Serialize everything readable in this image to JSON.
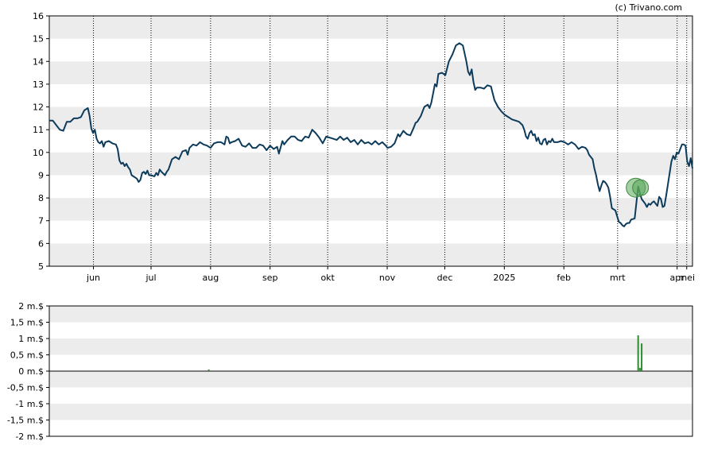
{
  "credit": "(c) Trivano.com",
  "chart_data": [
    {
      "type": "line",
      "ylim": [
        5,
        16
      ],
      "y_ticks": [
        "5",
        "6",
        "7",
        "8",
        "9",
        "10",
        "11",
        "12",
        "13",
        "14",
        "15",
        "16"
      ],
      "x_ticks": [
        "jun",
        "jul",
        "aug",
        "sep",
        "okt",
        "nov",
        "dec",
        "2025",
        "feb",
        "mrt",
        "apr",
        "mei"
      ],
      "grid": "vertical dotted at month boundaries, alternating horizontal bands",
      "line_color": "#0d3b5b",
      "x_range_days": [
        0,
        335
      ],
      "series": [
        {
          "points": [
            [
              0,
              11.4
            ],
            [
              2,
              11.4
            ],
            [
              4,
              11.2
            ],
            [
              6,
              11.0
            ],
            [
              8,
              10.95
            ],
            [
              10,
              11.35
            ],
            [
              12,
              11.35
            ],
            [
              14,
              11.5
            ],
            [
              16,
              11.5
            ],
            [
              18,
              11.55
            ],
            [
              20,
              11.85
            ],
            [
              22,
              11.95
            ],
            [
              23,
              11.6
            ],
            [
              24,
              11.05
            ],
            [
              25,
              10.85
            ],
            [
              26,
              11.0
            ],
            [
              27,
              10.6
            ],
            [
              28,
              10.45
            ],
            [
              29,
              10.4
            ],
            [
              30,
              10.5
            ],
            [
              31,
              10.25
            ],
            [
              32,
              10.45
            ],
            [
              34,
              10.5
            ],
            [
              36,
              10.4
            ],
            [
              38,
              10.35
            ],
            [
              39,
              10.15
            ],
            [
              40,
              9.65
            ],
            [
              41,
              9.5
            ],
            [
              42,
              9.55
            ],
            [
              43,
              9.4
            ],
            [
              44,
              9.5
            ],
            [
              45,
              9.35
            ],
            [
              46,
              9.25
            ],
            [
              47,
              9.0
            ],
            [
              48,
              8.95
            ],
            [
              50,
              8.85
            ],
            [
              51,
              8.7
            ],
            [
              52,
              8.8
            ],
            [
              53,
              9.1
            ],
            [
              54,
              9.15
            ],
            [
              55,
              9.05
            ],
            [
              56,
              9.2
            ],
            [
              57,
              9.0
            ],
            [
              58,
              9.0
            ],
            [
              60,
              8.95
            ],
            [
              61,
              9.1
            ],
            [
              62,
              9.0
            ],
            [
              63,
              9.25
            ],
            [
              64,
              9.15
            ],
            [
              66,
              9.0
            ],
            [
              67,
              9.15
            ],
            [
              68,
              9.25
            ],
            [
              70,
              9.7
            ],
            [
              72,
              9.8
            ],
            [
              74,
              9.7
            ],
            [
              76,
              10.05
            ],
            [
              78,
              10.1
            ],
            [
              79,
              9.9
            ],
            [
              80,
              10.2
            ],
            [
              82,
              10.35
            ],
            [
              84,
              10.3
            ],
            [
              86,
              10.45
            ],
            [
              88,
              10.35
            ],
            [
              90,
              10.3
            ],
            [
              92,
              10.2
            ],
            [
              94,
              10.4
            ],
            [
              96,
              10.45
            ],
            [
              98,
              10.45
            ],
            [
              100,
              10.35
            ],
            [
              101,
              10.7
            ],
            [
              102,
              10.65
            ],
            [
              103,
              10.4
            ],
            [
              104,
              10.45
            ],
            [
              106,
              10.5
            ],
            [
              108,
              10.6
            ],
            [
              110,
              10.3
            ],
            [
              112,
              10.25
            ],
            [
              114,
              10.4
            ],
            [
              116,
              10.2
            ],
            [
              118,
              10.2
            ],
            [
              120,
              10.35
            ],
            [
              122,
              10.3
            ],
            [
              124,
              10.1
            ],
            [
              126,
              10.3
            ],
            [
              128,
              10.15
            ],
            [
              130,
              10.25
            ],
            [
              131,
              9.95
            ],
            [
              133,
              10.5
            ],
            [
              134,
              10.35
            ],
            [
              136,
              10.55
            ],
            [
              138,
              10.7
            ],
            [
              140,
              10.7
            ],
            [
              142,
              10.55
            ],
            [
              144,
              10.5
            ],
            [
              146,
              10.7
            ],
            [
              148,
              10.65
            ],
            [
              150,
              11.0
            ],
            [
              152,
              10.85
            ],
            [
              154,
              10.65
            ],
            [
              156,
              10.4
            ],
            [
              158,
              10.7
            ],
            [
              160,
              10.65
            ],
            [
              162,
              10.6
            ],
            [
              164,
              10.55
            ],
            [
              166,
              10.7
            ],
            [
              168,
              10.55
            ],
            [
              170,
              10.65
            ],
            [
              172,
              10.45
            ],
            [
              174,
              10.55
            ],
            [
              176,
              10.35
            ],
            [
              178,
              10.55
            ],
            [
              180,
              10.4
            ],
            [
              182,
              10.45
            ],
            [
              184,
              10.35
            ],
            [
              186,
              10.5
            ],
            [
              188,
              10.35
            ],
            [
              190,
              10.45
            ],
            [
              192,
              10.3
            ],
            [
              193,
              10.2
            ],
            [
              195,
              10.25
            ],
            [
              197,
              10.4
            ],
            [
              199,
              10.8
            ],
            [
              200,
              10.7
            ],
            [
              202,
              10.95
            ],
            [
              204,
              10.8
            ],
            [
              206,
              10.75
            ],
            [
              208,
              11.1
            ],
            [
              209,
              11.3
            ],
            [
              210,
              11.35
            ],
            [
              212,
              11.6
            ],
            [
              214,
              12.0
            ],
            [
              216,
              12.1
            ],
            [
              217,
              11.95
            ],
            [
              218,
              12.2
            ],
            [
              219,
              12.6
            ],
            [
              220,
              13.0
            ],
            [
              221,
              12.9
            ],
            [
              222,
              13.45
            ],
            [
              224,
              13.5
            ],
            [
              226,
              13.4
            ],
            [
              228,
              14.0
            ],
            [
              230,
              14.3
            ],
            [
              232,
              14.7
            ],
            [
              234,
              14.8
            ],
            [
              236,
              14.7
            ],
            [
              237,
              14.35
            ],
            [
              238,
              14.0
            ],
            [
              239,
              13.55
            ],
            [
              240,
              13.4
            ],
            [
              241,
              13.65
            ],
            [
              242,
              13.1
            ],
            [
              243,
              12.75
            ],
            [
              244,
              12.85
            ],
            [
              246,
              12.85
            ],
            [
              248,
              12.8
            ],
            [
              250,
              12.95
            ],
            [
              252,
              12.9
            ],
            [
              253,
              12.6
            ],
            [
              254,
              12.3
            ],
            [
              256,
              12.0
            ],
            [
              258,
              11.8
            ],
            [
              260,
              11.65
            ],
            [
              262,
              11.55
            ],
            [
              264,
              11.45
            ],
            [
              266,
              11.4
            ],
            [
              268,
              11.35
            ],
            [
              270,
              11.2
            ],
            [
              271,
              11.0
            ],
            [
              272,
              10.7
            ],
            [
              273,
              10.6
            ],
            [
              274,
              10.85
            ],
            [
              275,
              10.95
            ],
            [
              276,
              10.75
            ],
            [
              277,
              10.8
            ],
            [
              278,
              10.5
            ],
            [
              279,
              10.65
            ],
            [
              280,
              10.4
            ],
            [
              281,
              10.35
            ],
            [
              282,
              10.55
            ],
            [
              283,
              10.6
            ],
            [
              284,
              10.35
            ],
            [
              285,
              10.5
            ],
            [
              286,
              10.45
            ],
            [
              287,
              10.6
            ],
            [
              288,
              10.45
            ],
            [
              290,
              10.45
            ],
            [
              292,
              10.5
            ],
            [
              294,
              10.45
            ],
            [
              296,
              10.35
            ],
            [
              298,
              10.45
            ],
            [
              300,
              10.35
            ],
            [
              302,
              10.15
            ],
            [
              304,
              10.25
            ],
            [
              306,
              10.2
            ],
            [
              307,
              10.1
            ],
            [
              308,
              9.9
            ],
            [
              310,
              9.7
            ],
            [
              311,
              9.3
            ],
            [
              312,
              9.0
            ],
            [
              313,
              8.6
            ],
            [
              314,
              8.3
            ],
            [
              315,
              8.55
            ],
            [
              316,
              8.75
            ],
            [
              317,
              8.7
            ],
            [
              318,
              8.6
            ],
            [
              319,
              8.45
            ],
            [
              320,
              8.05
            ],
            [
              321,
              7.55
            ],
            [
              322,
              7.5
            ],
            [
              323,
              7.45
            ],
            [
              324,
              7.2
            ],
            [
              325,
              6.95
            ],
            [
              326,
              6.9
            ],
            [
              327,
              6.8
            ],
            [
              328,
              6.75
            ],
            [
              329,
              6.85
            ],
            [
              330,
              6.9
            ],
            [
              331,
              6.9
            ],
            [
              332,
              7.05
            ]
          ]
        }
      ]
    },
    {
      "type": "bar",
      "ylim": [
        -2,
        2
      ],
      "y_ticks": [
        "-2 m.$",
        "-1,5 m.$",
        "-1 m.$",
        "-0,5 m.$",
        "0 m.$",
        "0,5 m.$",
        "1 m.$",
        "1,5 m.$",
        "2 m.$"
      ],
      "series": [
        {
          "points": [
            [
              91,
              0.05
            ],
            [
              302,
              1.1
            ],
            [
              303,
              0.1
            ],
            [
              304,
              0.85
            ]
          ]
        }
      ]
    }
  ]
}
